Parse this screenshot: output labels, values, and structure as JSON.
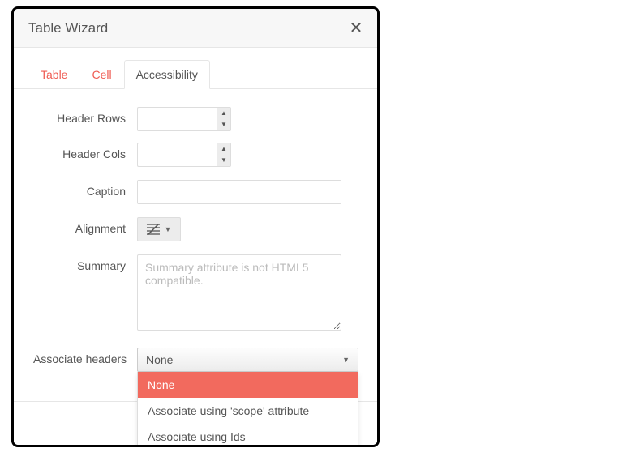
{
  "dialog": {
    "title": "Table Wizard"
  },
  "tabs": {
    "table": "Table",
    "cell": "Cell",
    "accessibility": "Accessibility"
  },
  "form": {
    "header_rows": {
      "label": "Header Rows",
      "value": ""
    },
    "header_cols": {
      "label": "Header Cols",
      "value": ""
    },
    "caption": {
      "label": "Caption",
      "value": ""
    },
    "alignment": {
      "label": "Alignment"
    },
    "summary": {
      "label": "Summary",
      "placeholder": "Summary attribute is not HTML5 compatible.",
      "value": ""
    },
    "associate_headers": {
      "label": "Associate headers",
      "selected": "None",
      "options": [
        "None",
        "Associate using 'scope' attribute",
        "Associate using Ids"
      ]
    }
  },
  "colors": {
    "accent": "#ef5b52",
    "highlight": "#f26a5e"
  }
}
